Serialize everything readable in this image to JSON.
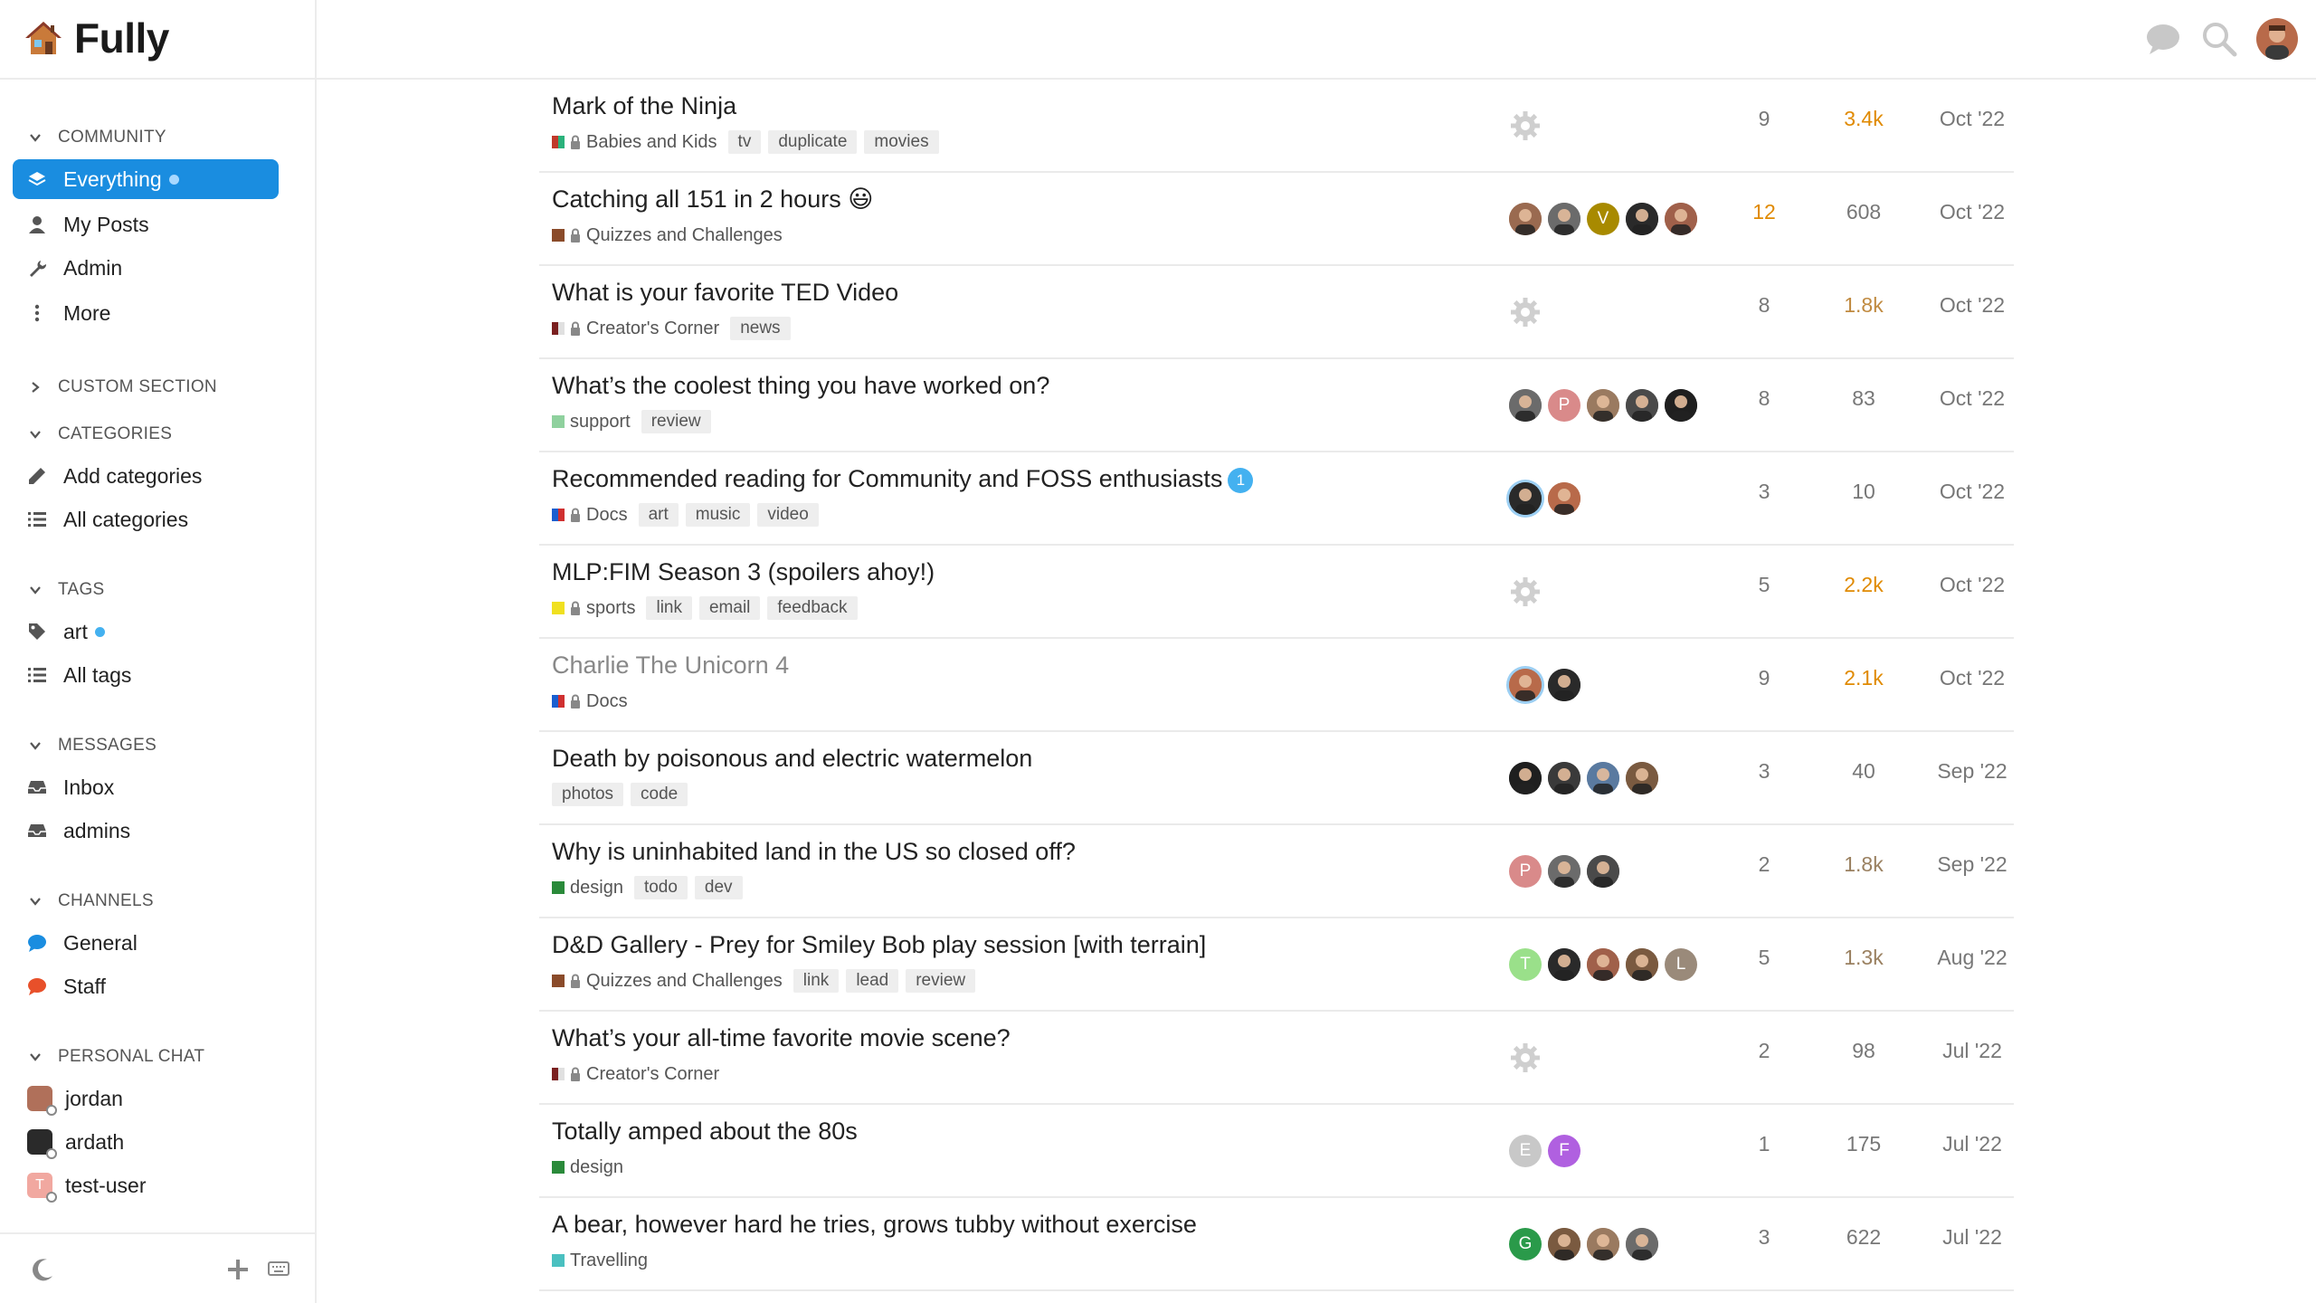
{
  "brand": {
    "name": "Fully",
    "logo_icon": "house-icon"
  },
  "sidebar": {
    "sections": [
      {
        "key": "community",
        "title": "COMMUNITY",
        "expanded": true,
        "items": [
          {
            "label": "Everything",
            "icon": "layers-icon",
            "active": true,
            "dot": true
          },
          {
            "label": "My Posts",
            "icon": "user-icon"
          },
          {
            "label": "Admin",
            "icon": "wrench-icon"
          },
          {
            "label": "More",
            "icon": "ellipsis-vertical-icon"
          }
        ]
      },
      {
        "key": "custom",
        "title": "CUSTOM SECTION",
        "expanded": false,
        "items": []
      },
      {
        "key": "categories",
        "title": "CATEGORIES",
        "expanded": true,
        "items": [
          {
            "label": "Add categories",
            "icon": "pencil-icon"
          },
          {
            "label": "All categories",
            "icon": "list-icon"
          }
        ]
      },
      {
        "key": "tags",
        "title": "TAGS",
        "expanded": true,
        "items": [
          {
            "label": "art",
            "icon": "tag-icon",
            "dot": true
          },
          {
            "label": "All tags",
            "icon": "list-icon"
          }
        ]
      },
      {
        "key": "messages",
        "title": "MESSAGES",
        "expanded": true,
        "items": [
          {
            "label": "Inbox",
            "icon": "inbox-icon"
          },
          {
            "label": "admins",
            "icon": "inbox-icon"
          }
        ]
      },
      {
        "key": "channels",
        "title": "CHANNELS",
        "expanded": true,
        "items": [
          {
            "label": "General",
            "icon": "chat-bubble-icon",
            "color": "#1a8de0"
          },
          {
            "label": "Staff",
            "icon": "chat-bubble-icon",
            "color": "#e8502a"
          }
        ]
      },
      {
        "key": "personal_chat",
        "title": "PERSONAL CHAT",
        "expanded": true,
        "items": [
          {
            "label": "jordan",
            "avatar_color": "#b0705a"
          },
          {
            "label": "ardath",
            "avatar_color": "#2a2a2a"
          },
          {
            "label": "test-user",
            "avatar_color": "#f1a8a0",
            "avatar_letter": "T"
          }
        ]
      }
    ]
  },
  "header": {
    "chat_icon": "chat-icon",
    "search_icon": "search-icon",
    "avatar_color": "#b86a4a"
  },
  "topics": [
    {
      "title": "Mark of the Ninja",
      "visited": false,
      "category": "Babies and Kids",
      "category_colors": [
        "#c0392b",
        "#2ab27b"
      ],
      "locked": true,
      "tags": [
        "tv",
        "duplicate",
        "movies"
      ],
      "posters": [
        {
          "type": "gear"
        }
      ],
      "replies": "9",
      "replies_class": "plain",
      "views": "3.4k",
      "views_class": "hot",
      "activity": "Oct '22"
    },
    {
      "title": "Catching all 151 in 2 hours 😃",
      "visited": false,
      "category": "Quizzes and Challenges",
      "category_colors": [
        "#8a4b2a",
        "#8a4b2a"
      ],
      "locked": true,
      "tags": [],
      "posters": [
        {
          "color": "#9a6a50"
        },
        {
          "color": "#6b6b6b"
        },
        {
          "color": "#a88a00",
          "letter": "V"
        },
        {
          "color": "#2a2a2a"
        },
        {
          "color": "#a0604a"
        }
      ],
      "replies": "12",
      "replies_class": "hot",
      "views": "608",
      "views_class": "plain",
      "activity": "Oct '22"
    },
    {
      "title": "What is your favorite TED Video",
      "visited": false,
      "category": "Creator's Corner",
      "category_colors": [
        "#7a1f1f",
        "#e0e0e0"
      ],
      "locked": true,
      "tags": [
        "news"
      ],
      "posters": [
        {
          "type": "gear"
        }
      ],
      "replies": "8",
      "replies_class": "plain",
      "views": "1.8k",
      "views_class": "warm",
      "activity": "Oct '22"
    },
    {
      "title": "What’s the coolest thing you have worked on?",
      "visited": false,
      "category": "support",
      "category_colors": [
        "#8fd19e",
        "#8fd19e"
      ],
      "locked": false,
      "tags": [
        "review"
      ],
      "posters": [
        {
          "color": "#6b6b6b"
        },
        {
          "color": "#d98a8a",
          "letter": "P"
        },
        {
          "color": "#9a7a60"
        },
        {
          "color": "#4a4a4a"
        },
        {
          "color": "#1f1f1f"
        }
      ],
      "replies": "8",
      "replies_class": "plain",
      "views": "83",
      "views_class": "plain",
      "activity": "Oct '22"
    },
    {
      "title": "Recommended reading for Community and FOSS enthusiasts",
      "visited": false,
      "badge": "1",
      "category": "Docs",
      "category_colors": [
        "#1a5fd0",
        "#d03030"
      ],
      "locked": true,
      "tags": [
        "art",
        "music",
        "video"
      ],
      "posters": [
        {
          "color": "#2a2a2a",
          "ring": true
        },
        {
          "color": "#b86a4a"
        }
      ],
      "replies": "3",
      "replies_class": "plain",
      "views": "10",
      "views_class": "plain",
      "activity": "Oct '22"
    },
    {
      "title": "MLP:FIM Season 3 (spoilers ahoy!)",
      "visited": false,
      "category": "sports",
      "category_colors": [
        "#f0e020",
        "#f0e020"
      ],
      "locked": true,
      "tags": [
        "link",
        "email",
        "feedback"
      ],
      "posters": [
        {
          "type": "gear"
        }
      ],
      "replies": "5",
      "replies_class": "plain",
      "views": "2.2k",
      "views_class": "hot",
      "activity": "Oct '22"
    },
    {
      "title": "Charlie The Unicorn 4",
      "visited": true,
      "category": "Docs",
      "category_colors": [
        "#1a5fd0",
        "#d03030"
      ],
      "locked": true,
      "tags": [],
      "posters": [
        {
          "color": "#b86a4a",
          "ring": true
        },
        {
          "color": "#2a2a2a"
        }
      ],
      "replies": "9",
      "replies_class": "plain",
      "views": "2.1k",
      "views_class": "hot",
      "activity": "Oct '22"
    },
    {
      "title": "Death by poisonous and electric watermelon",
      "visited": false,
      "category": "",
      "category_colors": [],
      "locked": false,
      "tags": [
        "photos",
        "code"
      ],
      "posters": [
        {
          "color": "#1f1f1f"
        },
        {
          "color": "#3a3a3a"
        },
        {
          "color": "#5a7aa0"
        },
        {
          "color": "#7a5a40"
        }
      ],
      "replies": "3",
      "replies_class": "plain",
      "views": "40",
      "views_class": "plain",
      "activity": "Sep '22"
    },
    {
      "title": "Why is uninhabited land in the US so closed off?",
      "visited": false,
      "category": "design",
      "category_colors": [
        "#2a8a3a",
        "#2a8a3a"
      ],
      "locked": false,
      "tags": [
        "todo",
        "dev"
      ],
      "posters": [
        {
          "color": "#d98a8a",
          "letter": "P"
        },
        {
          "color": "#6b6b6b"
        },
        {
          "color": "#4a4a4a"
        }
      ],
      "replies": "2",
      "replies_class": "plain",
      "views": "1.8k",
      "views_class": "mild",
      "activity": "Sep '22"
    },
    {
      "title": "D&D Gallery - Prey for Smiley Bob play session [with terrain]",
      "visited": false,
      "category": "Quizzes and Challenges",
      "category_colors": [
        "#8a4b2a",
        "#8a4b2a"
      ],
      "locked": true,
      "tags": [
        "link",
        "lead",
        "review"
      ],
      "posters": [
        {
          "color": "#9ae08a",
          "letter": "T"
        },
        {
          "color": "#2a2a2a"
        },
        {
          "color": "#a0604a"
        },
        {
          "color": "#7a5a40"
        },
        {
          "color": "#9a8a7a",
          "letter": "L"
        }
      ],
      "replies": "5",
      "replies_class": "plain",
      "views": "1.3k",
      "views_class": "mild",
      "activity": "Aug '22"
    },
    {
      "title": "What’s your all-time favorite movie scene?",
      "visited": false,
      "category": "Creator's Corner",
      "category_colors": [
        "#7a1f1f",
        "#e0e0e0"
      ],
      "locked": true,
      "tags": [],
      "posters": [
        {
          "type": "gear"
        }
      ],
      "replies": "2",
      "replies_class": "plain",
      "views": "98",
      "views_class": "plain",
      "activity": "Jul '22"
    },
    {
      "title": "Totally amped about the 80s",
      "visited": false,
      "category": "design",
      "category_colors": [
        "#2a8a3a",
        "#2a8a3a"
      ],
      "locked": false,
      "tags": [],
      "posters": [
        {
          "color": "#c8c8c8",
          "letter": "E"
        },
        {
          "color": "#b060e0",
          "letter": "F"
        }
      ],
      "replies": "1",
      "replies_class": "plain",
      "views": "175",
      "views_class": "plain",
      "activity": "Jul '22"
    },
    {
      "title": "A bear, however hard he tries, grows tubby without exercise",
      "visited": false,
      "category": "Travelling",
      "category_colors": [
        "#4ac0c0",
        "#4ac0c0"
      ],
      "locked": false,
      "tags": [],
      "posters": [
        {
          "color": "#2a9a4a",
          "letter": "G"
        },
        {
          "color": "#7a5a40"
        },
        {
          "color": "#9a7a60"
        },
        {
          "color": "#6b6b6b"
        }
      ],
      "replies": "3",
      "replies_class": "plain",
      "views": "622",
      "views_class": "plain",
      "activity": "Jul '22"
    }
  ]
}
